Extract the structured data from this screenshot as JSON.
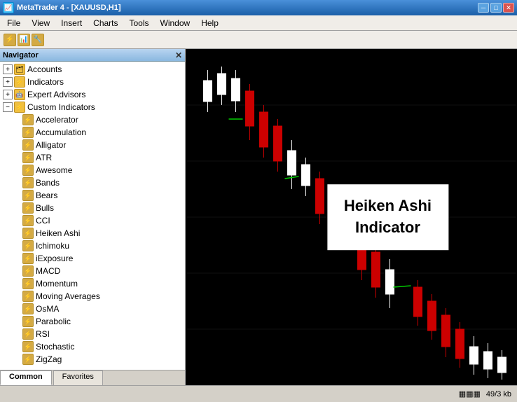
{
  "titlebar": {
    "icon": "📈",
    "title": "MetaTrader 4 - [XAUUSD,H1]",
    "minimize": "─",
    "maximize": "□",
    "close": "✕"
  },
  "menubar": {
    "items": [
      "File",
      "View",
      "Insert",
      "Charts",
      "Tools",
      "Window",
      "Help"
    ]
  },
  "navigator": {
    "title": "Navigator",
    "close": "✕",
    "tree": {
      "accounts": "Accounts",
      "indicators": "Indicators",
      "expertAdvisors": "Expert Advisors",
      "customIndicators": "Custom Indicators",
      "items": [
        "Accelerator",
        "Accumulation",
        "Alligator",
        "ATR",
        "Awesome",
        "Bands",
        "Bears",
        "Bulls",
        "CCI",
        "Heiken Ashi",
        "Ichimoku",
        "iExposure",
        "MACD",
        "Momentum",
        "Moving Averages",
        "OsMA",
        "Parabolic",
        "RSI",
        "Stochastic",
        "ZigZag"
      ]
    },
    "tabs": [
      "Common",
      "Favorites"
    ]
  },
  "chart": {
    "label_line1": "Heiken Ashi",
    "label_line2": "Indicator"
  },
  "statusbar": {
    "info_icon": "▦",
    "data": "49/3 kb"
  }
}
